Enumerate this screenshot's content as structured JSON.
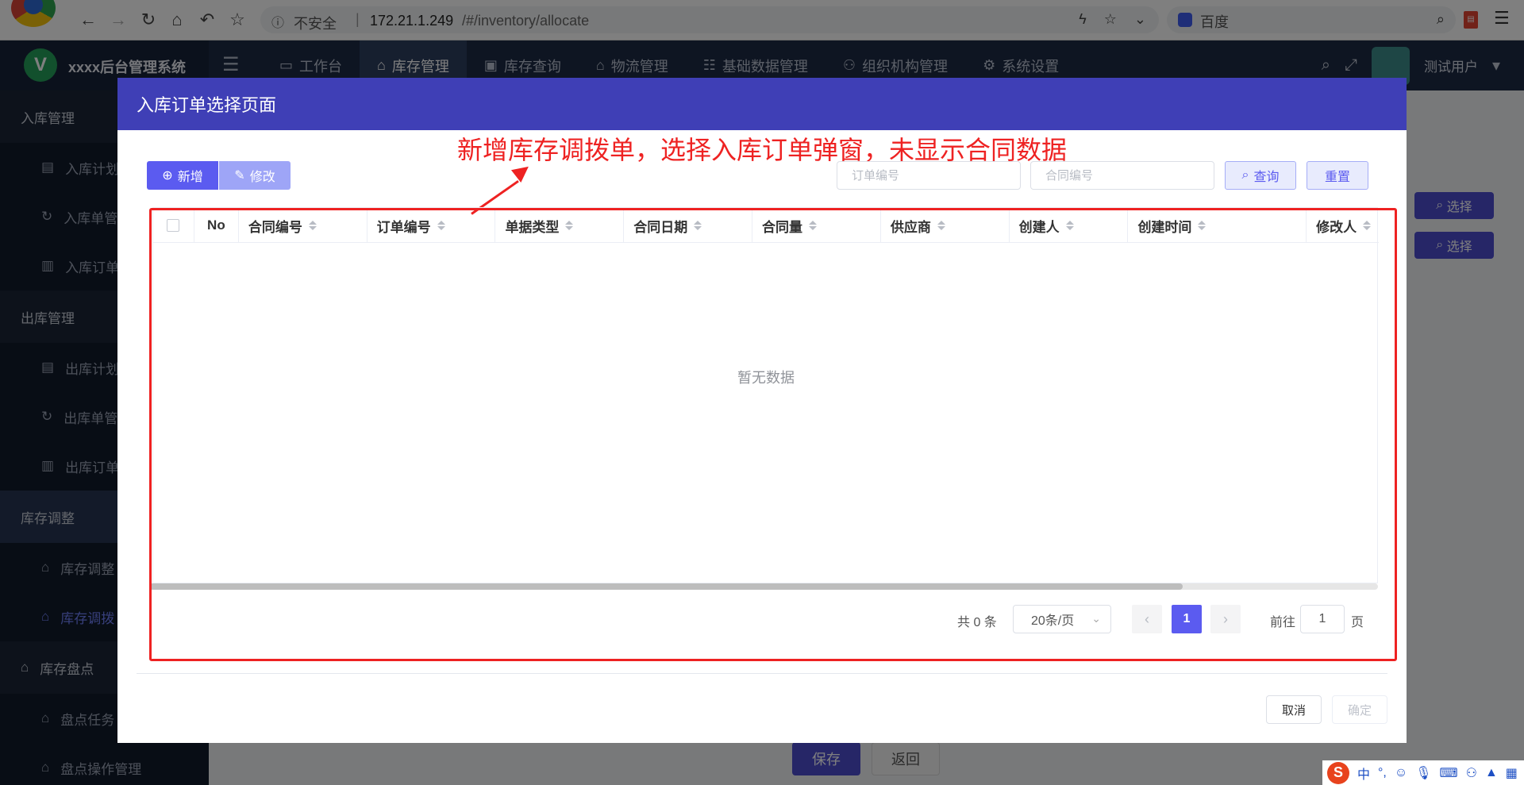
{
  "browser": {
    "url_insecure": "不安全",
    "url_sep": "|",
    "url_host": "172.21.1.249",
    "url_path": "/#/inventory/allocate",
    "search_engine": "百度"
  },
  "app": {
    "title": "xxxx后台管理系统",
    "logo_letter": "V",
    "user": "测试用户",
    "nav": [
      {
        "label": "工作台",
        "icon": "monitor-icon"
      },
      {
        "label": "库存管理",
        "icon": "home-icon"
      },
      {
        "label": "库存查询",
        "icon": "display-icon"
      },
      {
        "label": "物流管理",
        "icon": "home-icon"
      },
      {
        "label": "基础数据管理",
        "icon": "list-icon"
      },
      {
        "label": "组织机构管理",
        "icon": "org-icon"
      },
      {
        "label": "系统设置",
        "icon": "gear-icon"
      }
    ]
  },
  "sidebar": {
    "groups": [
      {
        "label": "入库管理",
        "items": [
          "入库计划",
          "入库单管理",
          "入库订单"
        ]
      },
      {
        "label": "出库管理",
        "items": [
          "出库计划",
          "出库单管理",
          "出库订单"
        ]
      },
      {
        "label": "库存调整",
        "items": [
          "库存调整",
          "库存调拨"
        ]
      },
      {
        "label": "库存盘点",
        "items": [
          "盘点任务",
          "盘点操作管理"
        ]
      }
    ]
  },
  "background": {
    "select_label": "选择",
    "save_label": "保存",
    "back_label": "返回"
  },
  "dialog": {
    "title": "入库订单选择页面",
    "annotation": "新增库存调拨单，选择入库订单弹窗，未显示合同数据",
    "add_label": "新增",
    "edit_label": "修改",
    "order_no_placeholder": "订单编号",
    "contract_no_placeholder": "合同编号",
    "query_label": "查询",
    "reset_label": "重置",
    "table": {
      "columns": [
        "No",
        "合同编号",
        "订单编号",
        "单据类型",
        "合同日期",
        "合同量",
        "供应商",
        "创建人",
        "创建时间",
        "修改人"
      ],
      "empty_text": "暂无数据"
    },
    "pager": {
      "total": "共 0 条",
      "page_size": "20条/页",
      "current_page": "1",
      "goto_label": "前往",
      "goto_value": "1",
      "page_label": "页"
    },
    "cancel_label": "取消",
    "confirm_label": "确定"
  },
  "ime": {
    "label": "中"
  },
  "colors": {
    "primary": "#5b5bf0",
    "dialog_header": "#3f3fb6",
    "annotation": "#ee2222",
    "header_bg": "#1d2b45"
  }
}
